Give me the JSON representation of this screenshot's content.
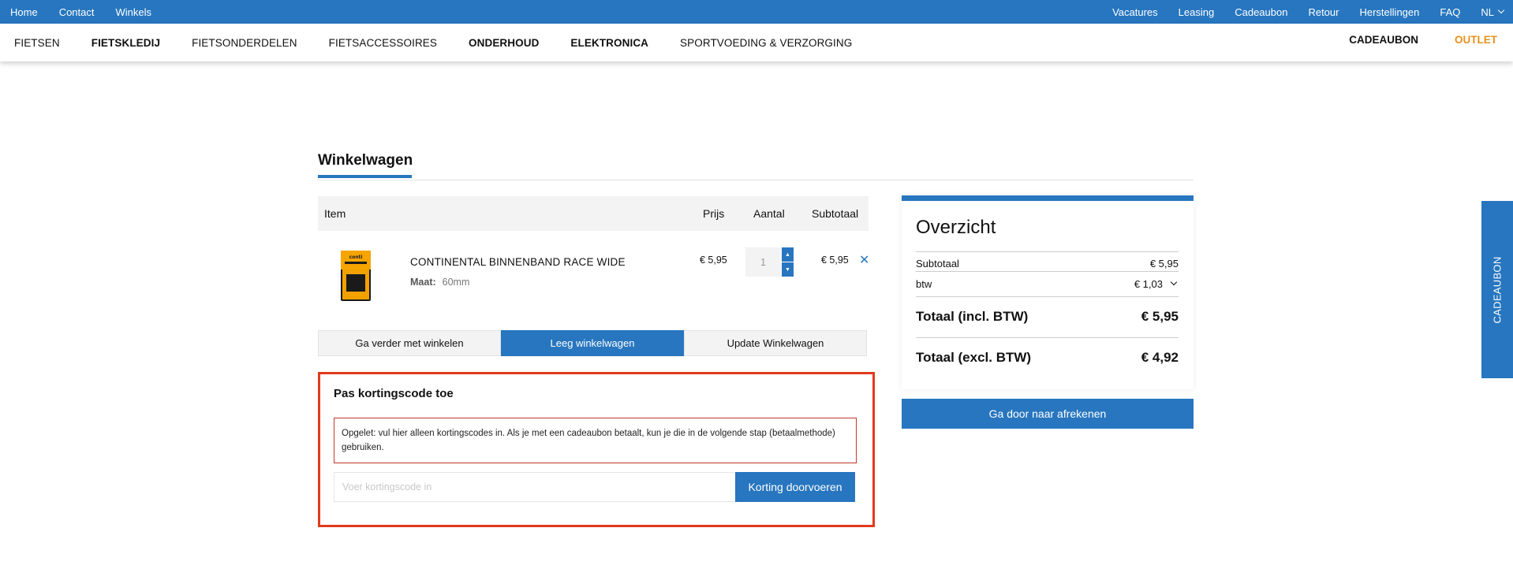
{
  "topbar": {
    "left_links": [
      "Home",
      "Contact",
      "Winkels"
    ],
    "right_links": [
      "Vacatures",
      "Leasing",
      "Cadeaubon",
      "Retour",
      "Herstellingen",
      "FAQ"
    ],
    "language": "NL"
  },
  "mainnav": {
    "categories": [
      "FIETSEN",
      "FIETSKLEDIJ",
      "FIETSONDERDELEN",
      "FIETSACCESSOIRES",
      "ONDERHOUD",
      "ELEKTRONICA",
      "SPORTVOEDING & VERZORGING"
    ],
    "cadeaubon": "CADEAUBON",
    "outlet": "OUTLET"
  },
  "page": {
    "title": "Winkelwagen"
  },
  "cart": {
    "headers": {
      "item": "Item",
      "price": "Prijs",
      "qty": "Aantal",
      "subtotal": "Subtotaal"
    },
    "item": {
      "name": "CONTINENTAL BINNENBAND RACE WIDE",
      "size_label": "Maat:",
      "size_value": "60mm",
      "price": "€ 5,95",
      "qty": "1",
      "subtotal": "€ 5,95",
      "thumb_brand": "conti"
    },
    "actions": {
      "continue": "Ga verder met winkelen",
      "clear": "Leeg winkelwagen",
      "update": "Update Winkelwagen"
    }
  },
  "coupon": {
    "title": "Pas kortingscode toe",
    "notice": "Opgelet: vul hier alleen kortingscodes in. Als je met een cadeaubon betaalt, kun je die in de volgende stap (betaalmethode) gebruiken.",
    "placeholder": "Voer kortingscode in",
    "apply": "Korting doorvoeren"
  },
  "summary": {
    "title": "Overzicht",
    "subtotal_label": "Subtotaal",
    "subtotal_value": "€ 5,95",
    "btw_label": "btw",
    "btw_value": "€ 1,03",
    "total_incl_label": "Totaal (incl. BTW)",
    "total_incl_value": "€ 5,95",
    "total_excl_label": "Totaal (excl. BTW)",
    "total_excl_value": "€ 4,92",
    "checkout": "Ga door naar afrekenen"
  },
  "sidetab": {
    "label": "CADEAUBON"
  },
  "colors": {
    "primary": "#2776bf",
    "outlet": "#e8911a",
    "highlight_border": "#e03a1d"
  }
}
